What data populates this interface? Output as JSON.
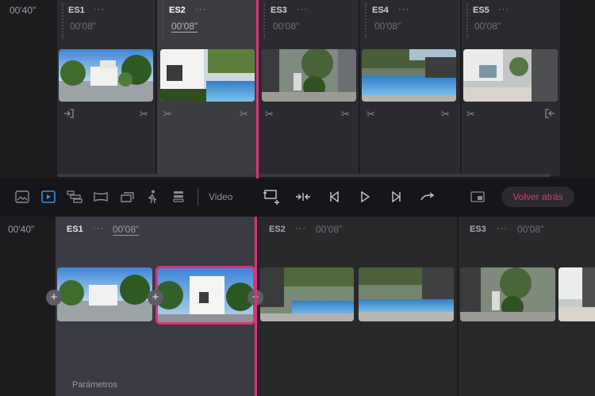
{
  "top": {
    "time_label": "00'40\"",
    "segments": [
      {
        "name": "ES1",
        "menu": "···",
        "duration": "00'08\""
      },
      {
        "name": "ES2",
        "menu": "···",
        "duration": "00'08\""
      },
      {
        "name": "ES3",
        "menu": "···",
        "duration": "00'08\""
      },
      {
        "name": "ES4",
        "menu": "···",
        "duration": "00'08\""
      },
      {
        "name": "ES5",
        "menu": "···",
        "duration": "00'08\""
      }
    ]
  },
  "toolbar": {
    "video_label": "Video",
    "back_button": "Volver atrás",
    "icons": [
      "image-icon",
      "video-play-icon",
      "layers-icon",
      "panorama-icon",
      "gallery-icon",
      "walk-icon",
      "stack-icon"
    ],
    "accent_color": "#e0317c"
  },
  "bottom": {
    "time_label": "00'40\"",
    "segments": [
      {
        "name": "ES1",
        "menu": "···",
        "duration": "00'08\""
      },
      {
        "name": "ES2",
        "menu": "···",
        "duration": "00'08\""
      },
      {
        "name": "ES3",
        "menu": "···",
        "duration": "00'08\""
      }
    ],
    "params_label": "Parámetros"
  }
}
